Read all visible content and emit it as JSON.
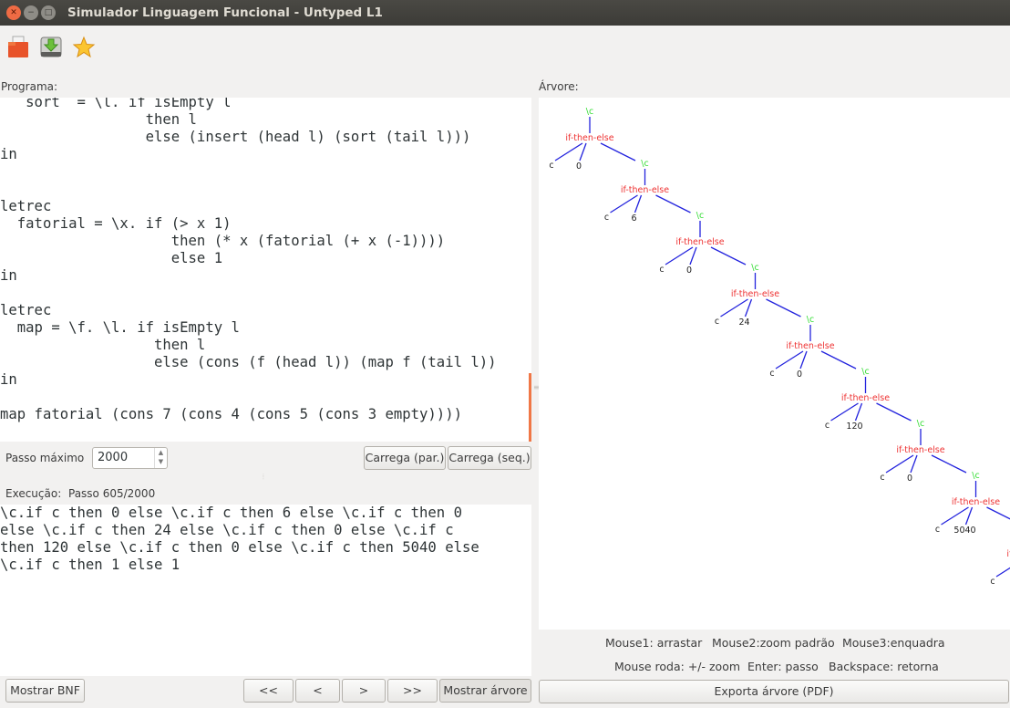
{
  "window": {
    "title": "Simulador Linguagem Funcional - Untyped L1",
    "controls": [
      "close",
      "minimize",
      "maximize"
    ]
  },
  "toolbar": {
    "items": [
      {
        "icon": "open-folder-icon",
        "label": "Abrir"
      },
      {
        "icon": "save-download-icon",
        "label": "Salvar"
      },
      {
        "icon": "star-icon",
        "label": "Favoritos"
      }
    ]
  },
  "program": {
    "label": "Programa:",
    "lines": [
      "   sort  = \\l. if isEmpty l",
      "                 then l",
      "                 else (insert (head l) (sort (tail l)))",
      "in",
      "",
      "",
      "letrec",
      "  fatorial = \\x. if (> x 1)",
      "                    then (* x (fatorial (+ x (-1))))",
      "                    else 1",
      "in",
      "",
      "letrec",
      "  map = \\f. \\l. if isEmpty l",
      "                  then l",
      "                  else (cons (f (head l)) (map f (tail l))",
      "in",
      "",
      "map fatorial (cons 7 (cons 4 (cons 5 (cons 3 empty))))"
    ]
  },
  "controls": {
    "max_step_label": "Passo máximo",
    "max_step_value": "2000",
    "load_par_label": "Carrega (par.)",
    "load_seq_label": "Carrega (seq.)"
  },
  "execution": {
    "label": "Execução:",
    "step_text": "Passo 605/2000",
    "lines": [
      "\\c.if c then 0 else \\c.if c then 6 else \\c.if c then 0",
      "else \\c.if c then 24 else \\c.if c then 0 else \\c.if c",
      "then 120 else \\c.if c then 0 else \\c.if c then 5040 else",
      "\\c.if c then 1 else 1"
    ]
  },
  "bottom_left": {
    "show_bnf_label": "Mostrar BNF",
    "first_label": "<<",
    "prev_label": "<",
    "next_label": ">",
    "last_label": ">>",
    "show_tree_label": "Mostrar árvore"
  },
  "tree": {
    "label": "Árvore:",
    "lambda_label": "\\c",
    "cond_label": "if-then-else",
    "var_label": "c",
    "then_values": [
      "0",
      "6",
      "0",
      "24",
      "0",
      "120",
      "0",
      "5040"
    ],
    "colors": {
      "lambda": "#33dd33",
      "cond": "#ee3333",
      "leaf": "#222222",
      "edge": "#2222dd"
    }
  },
  "hints": {
    "line1": [
      "Mouse1: arrastar",
      "Mouse2:zoom padrão",
      "Mouse3:enquadra"
    ],
    "line2": [
      "Mouse roda: +/- zoom",
      "Enter: passo",
      "Backspace: retorna"
    ]
  },
  "export_label": "Exporta árvore (PDF)"
}
